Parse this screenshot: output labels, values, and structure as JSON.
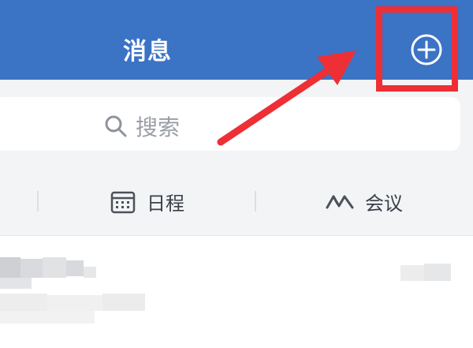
{
  "header": {
    "title": "消息"
  },
  "search": {
    "placeholder": "搜索"
  },
  "quick_actions": [
    {
      "label": "日程",
      "icon": "calendar-icon"
    },
    {
      "label": "会议",
      "icon": "meeting-icon"
    }
  ],
  "colors": {
    "header_bg": "#3b73c5",
    "highlight": "#ee2f35",
    "page_bg": "#f3f4f6"
  }
}
